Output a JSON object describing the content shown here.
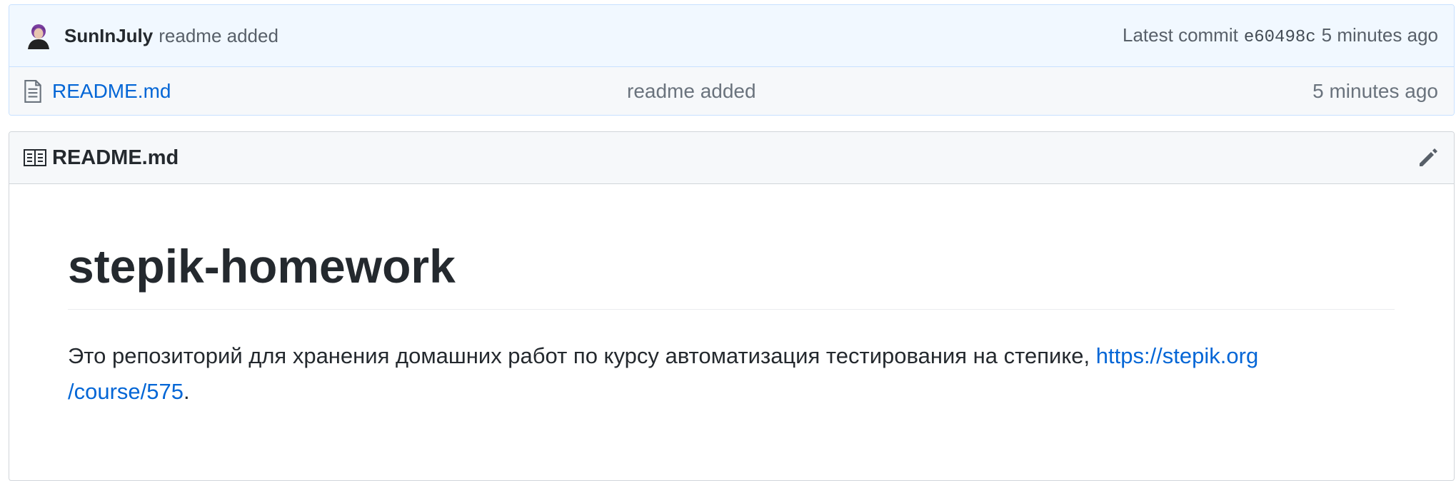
{
  "commit": {
    "author": "SunInJuly",
    "message": "readme added",
    "latest_label": "Latest commit",
    "sha": "e60498c",
    "age": "5 minutes ago"
  },
  "files": [
    {
      "name": "README.md",
      "message": "readme added",
      "age": "5 minutes ago",
      "icon": "file-icon"
    }
  ],
  "readme": {
    "header_title": "README.md",
    "header_icon": "book-icon",
    "edit_icon": "pencil-icon",
    "title": "stepik-homework",
    "text": "Это репозиторий для хранения домашних работ по курсу автоматизация тестирования на степике, ",
    "link_line1": "https://stepik.org",
    "link_line2": "/course/575",
    "suffix": "."
  },
  "colors": {
    "link": "#0366d6",
    "commit_bar_bg": "#f1f8ff",
    "text": "#24292e",
    "muted": "#586069"
  }
}
